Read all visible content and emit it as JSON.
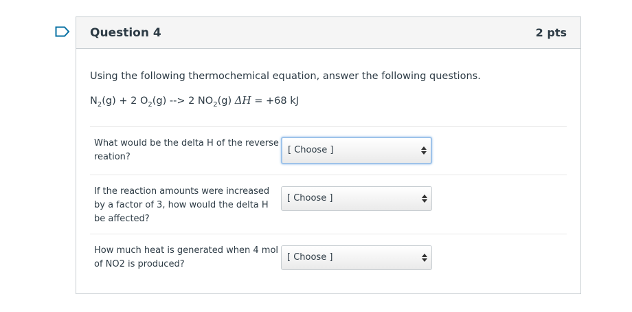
{
  "question": {
    "title": "Question 4",
    "points": "2 pts",
    "intro": "Using the following thermochemical equation, answer the following questions.",
    "equation": {
      "part1": "N",
      "sub1": "2",
      "part2": "(g) + 2 O",
      "sub2": "2",
      "part3": "(g) --> 2 NO",
      "sub3": "2",
      "part4": "(g) ",
      "delta_h": "ΔH",
      "part5": " = +68 kJ"
    },
    "items": [
      {
        "text": "What would be the delta H of the reverse reation?",
        "selected": "[ Choose ]"
      },
      {
        "text": "If the reaction amounts were increased by a factor of 3, how would the delta H be affected?",
        "selected": "[ Choose ]"
      },
      {
        "text": "How much heat is generated when 4 mol of NO2 is produced?",
        "selected": "[ Choose ]"
      }
    ]
  },
  "icons": {
    "flag": "bookmark-flag-icon",
    "select_arrows": "up-down-arrows-icon"
  },
  "colors": {
    "flag": "#0770a3",
    "border": "#c7cdd1",
    "header_bg": "#f5f5f5",
    "focus_ring": "#9ec3ea"
  }
}
